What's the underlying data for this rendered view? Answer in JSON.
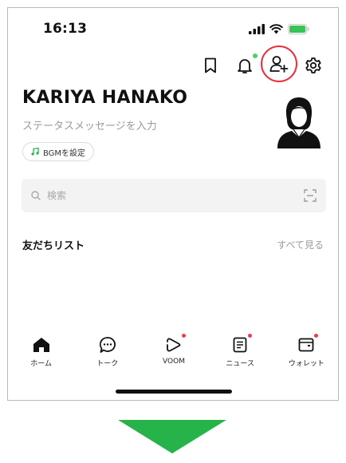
{
  "status_bar": {
    "time": "16:13"
  },
  "profile": {
    "name": "KARIYA HANAKO",
    "status_message_placeholder": "ステータスメッセージを入力",
    "bgm_label": "BGMを設定"
  },
  "search": {
    "placeholder": "検索"
  },
  "friends": {
    "title": "友だちリスト",
    "see_all": "すべて見る"
  },
  "tabs": [
    {
      "label": "ホーム",
      "icon": "home-icon",
      "badge": false
    },
    {
      "label": "トーク",
      "icon": "chat-icon",
      "badge": false
    },
    {
      "label": "VOOM",
      "icon": "voom-icon",
      "badge": true
    },
    {
      "label": "ニュース",
      "icon": "news-icon",
      "badge": true
    },
    {
      "label": "ウォレット",
      "icon": "wallet-icon",
      "badge": true
    }
  ],
  "header_icons": [
    "bookmark-icon",
    "bell-icon",
    "add-friend-icon",
    "settings-icon"
  ],
  "colors": {
    "highlight": "#e8303b",
    "badge_red": "#ef3b4b",
    "badge_green": "#4cd264",
    "arrow": "#25b34a",
    "battery": "#38c455"
  }
}
